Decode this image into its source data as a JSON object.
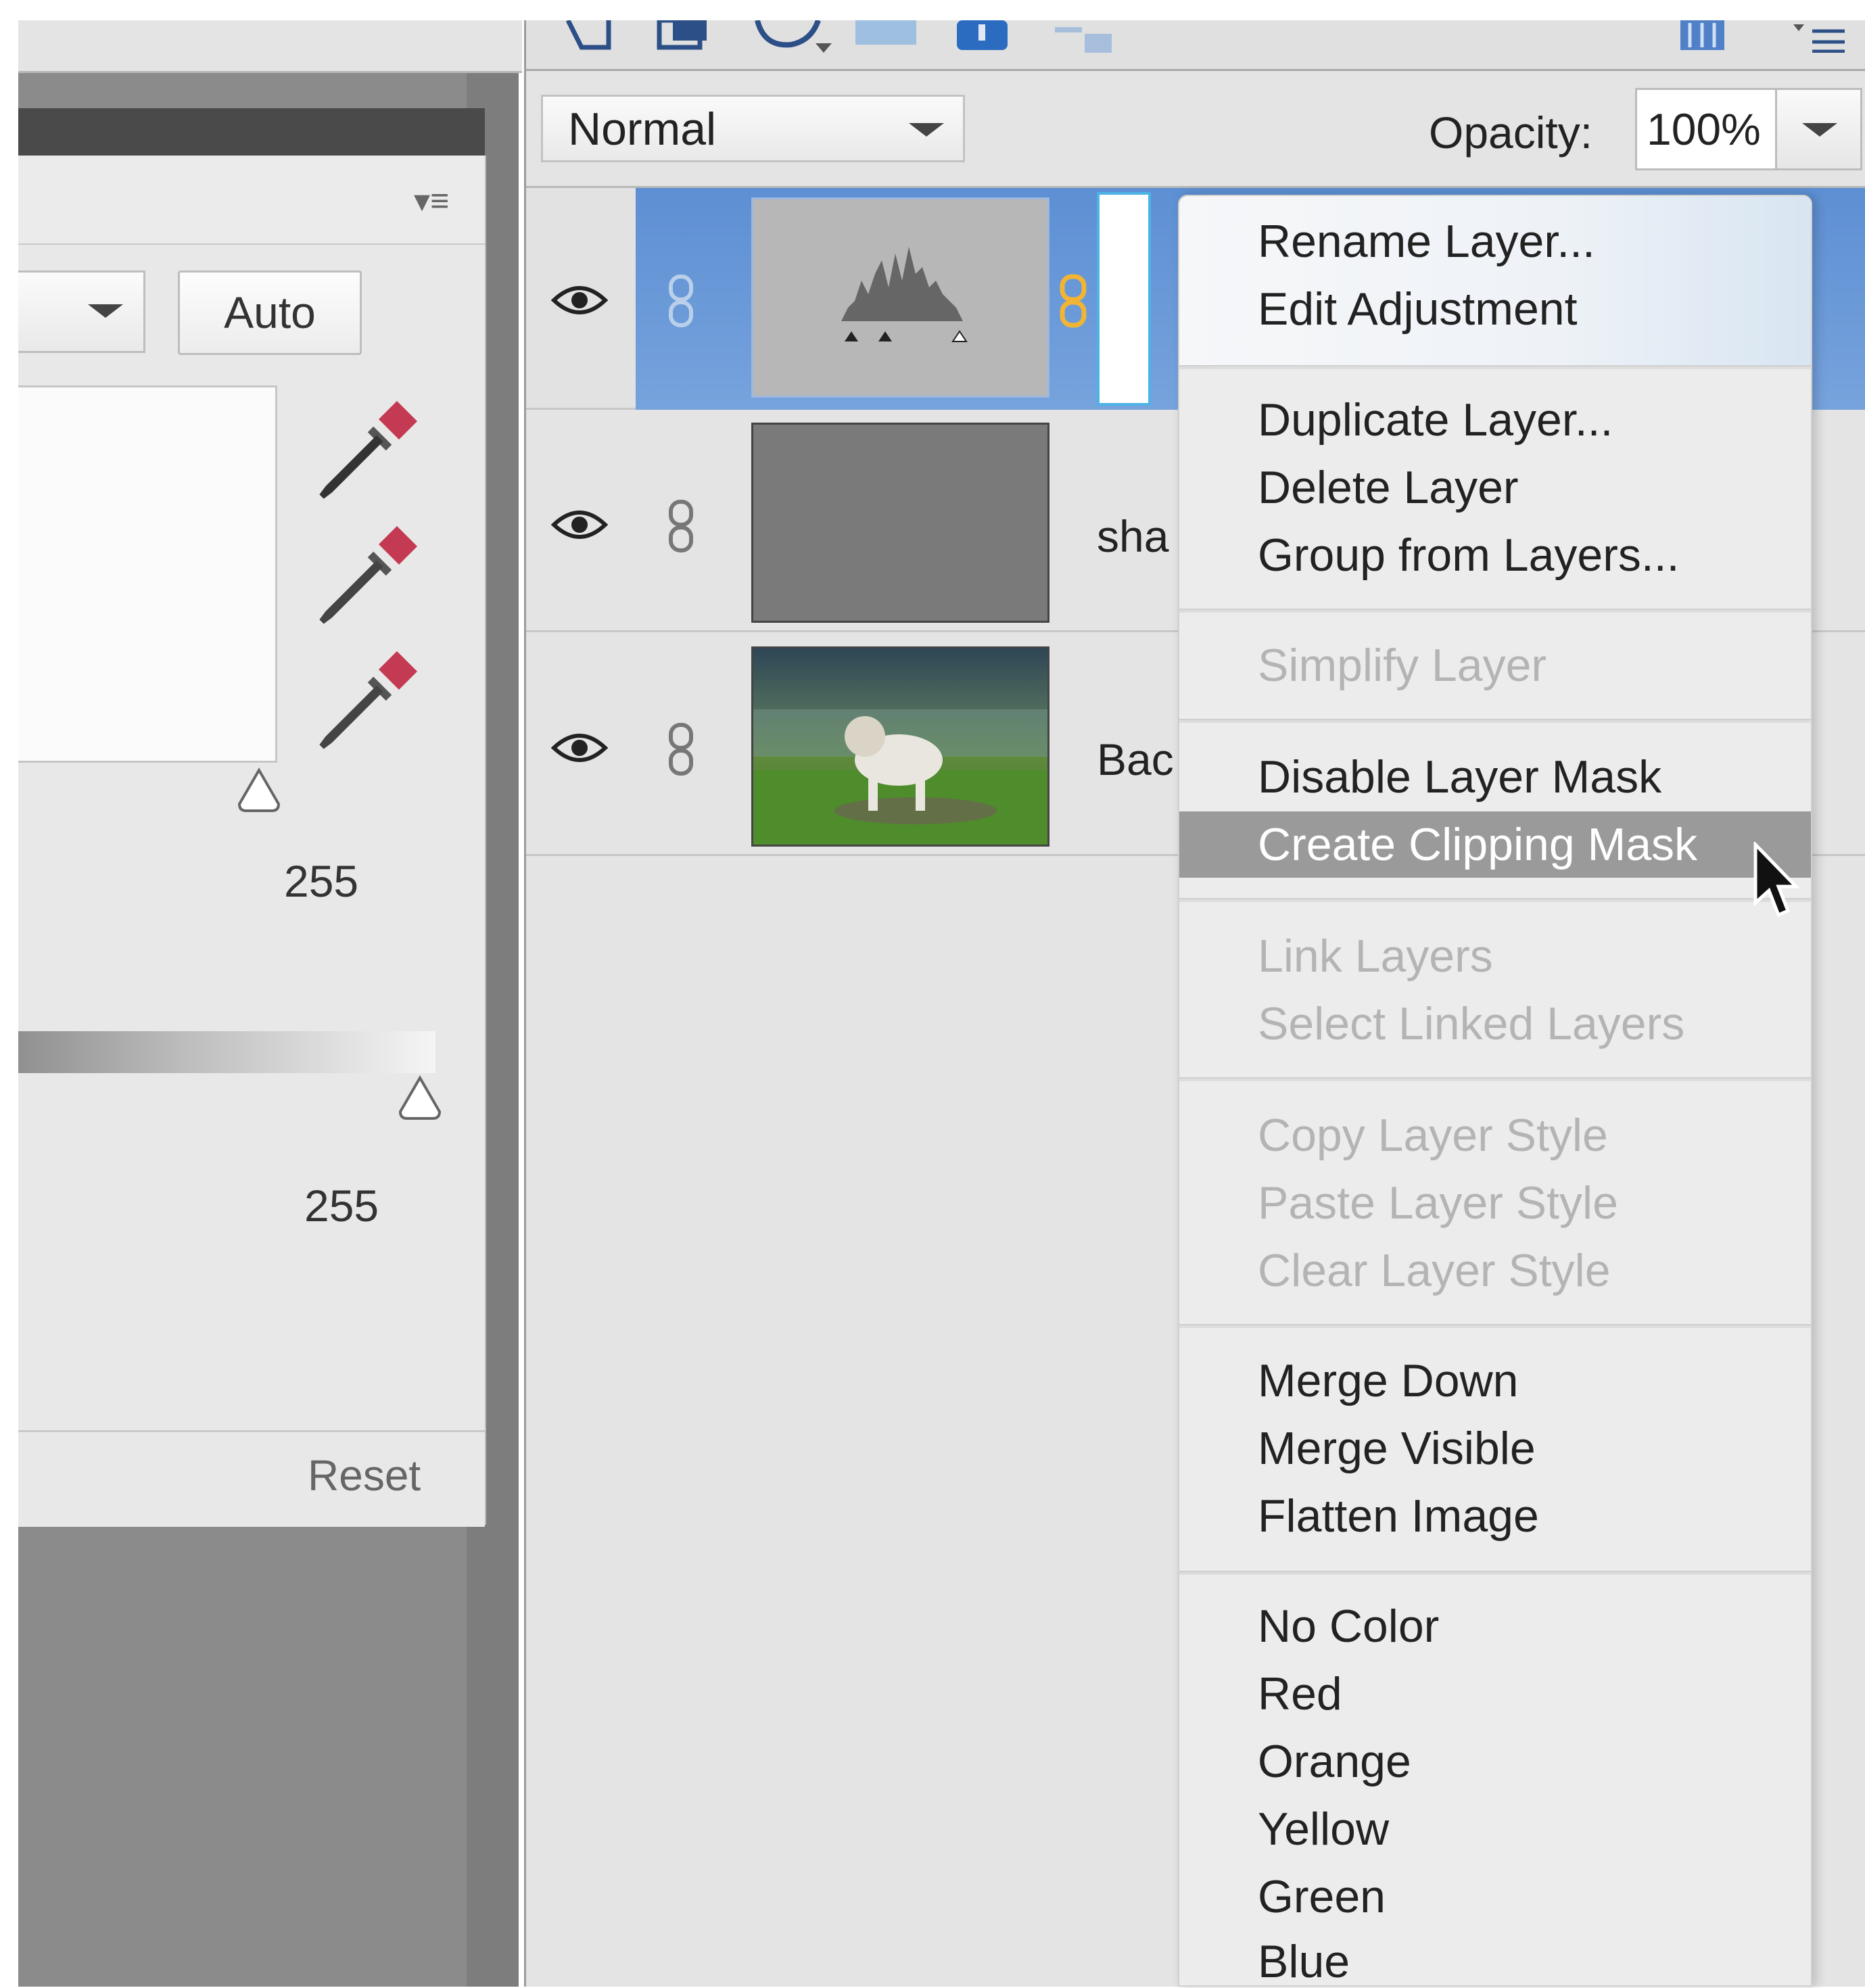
{
  "levels_panel": {
    "auto_label": "Auto",
    "input_white_value": "255",
    "output_white_value": "255",
    "reset_label": "Reset",
    "icons": [
      "panel-menu-icon",
      "eyedropper-black-icon",
      "eyedropper-gray-icon",
      "eyedropper-white-icon"
    ]
  },
  "layers_panel": {
    "blend_mode": "Normal",
    "opacity_label": "Opacity:",
    "opacity_value": "100%",
    "layers": [
      {
        "name": "",
        "type": "levels-adjustment",
        "selected": true
      },
      {
        "name": "sha",
        "type": "shape"
      },
      {
        "name": "Bac",
        "type": "background"
      }
    ],
    "selection_color": "#6b9bd8"
  },
  "context_menu": {
    "group1": [
      "Rename Layer...",
      "Edit Adjustment"
    ],
    "group2": [
      "Duplicate Layer...",
      "Delete Layer",
      "Group from Layers..."
    ],
    "group3": [
      "Simplify Layer"
    ],
    "group4": [
      "Disable Layer Mask",
      "Create Clipping Mask"
    ],
    "group5": [
      "Link Layers",
      "Select Linked Layers"
    ],
    "group6": [
      "Copy Layer Style",
      "Paste Layer Style",
      "Clear Layer Style"
    ],
    "group7": [
      "Merge Down",
      "Merge Visible",
      "Flatten Image"
    ],
    "group8": [
      "No Color",
      "Red",
      "Orange",
      "Yellow",
      "Green",
      "Blue"
    ],
    "highlighted": "Create Clipping Mask",
    "disabled": [
      "Simplify Layer",
      "Link Layers",
      "Select Linked Layers",
      "Copy Layer Style",
      "Paste Layer Style",
      "Clear Layer Style"
    ]
  }
}
